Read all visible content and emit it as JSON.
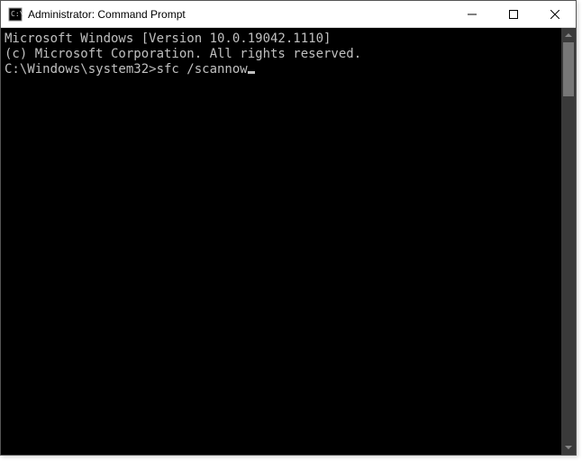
{
  "window": {
    "title": "Administrator: Command Prompt"
  },
  "terminal": {
    "line1": "Microsoft Windows [Version 10.0.19042.1110]",
    "line2": "(c) Microsoft Corporation. All rights reserved.",
    "blank": "",
    "prompt": "C:\\Windows\\system32>",
    "command": "sfc /scannow"
  }
}
